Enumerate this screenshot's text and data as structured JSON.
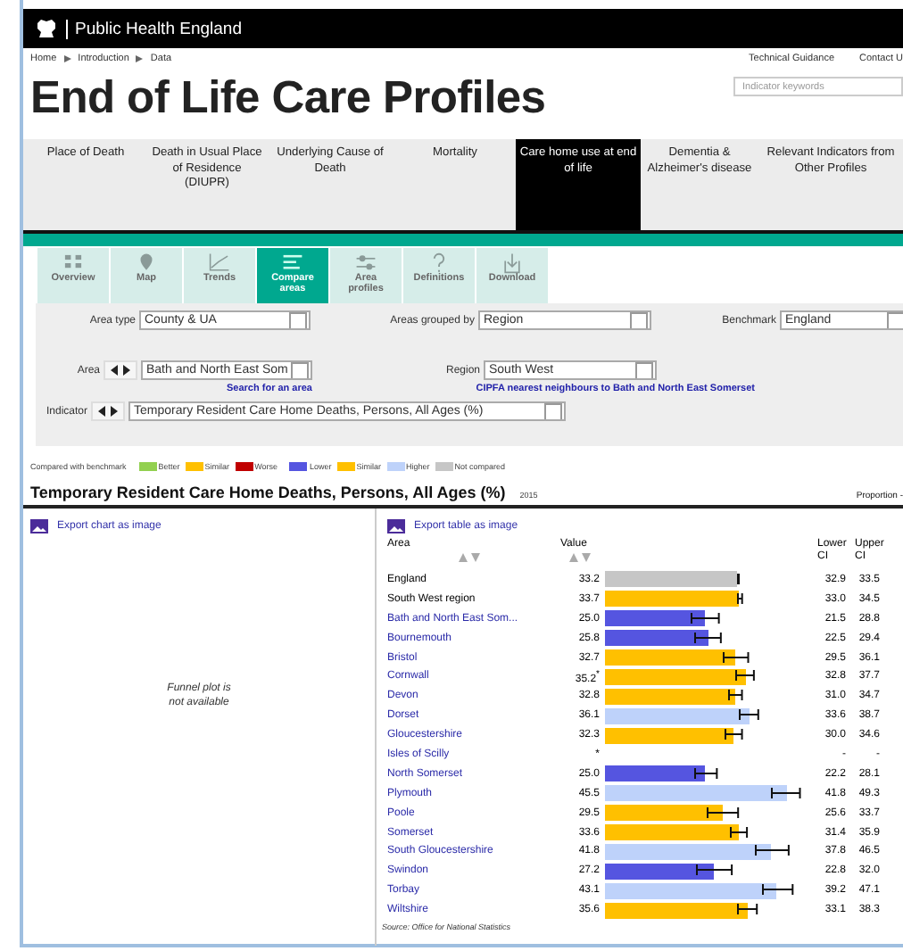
{
  "header": {
    "org": "Public Health England"
  },
  "breadcrumb": [
    "Home",
    "Introduction",
    "Data"
  ],
  "top_links": [
    "Technical Guidance",
    "Contact U"
  ],
  "title": "End of Life Care Profiles",
  "search": {
    "placeholder": "Indicator keywords"
  },
  "nav": [
    {
      "label": "Place of Death",
      "selected": false
    },
    {
      "label": "Death in Usual Place of Residence (DIUPR)",
      "selected": false
    },
    {
      "label": "Underlying Cause of Death",
      "selected": false
    },
    {
      "label": "Mortality",
      "selected": false
    },
    {
      "label": "Care home use at end of life",
      "selected": true
    },
    {
      "label": "Dementia & Alzheimer's disease",
      "selected": false
    },
    {
      "label": "Relevant Indicators from Other Profiles",
      "selected": false
    }
  ],
  "tools": [
    {
      "kind": "overview",
      "label": "Overview",
      "selected": false
    },
    {
      "kind": "map",
      "label": "Map",
      "selected": false
    },
    {
      "kind": "trends",
      "label": "Trends",
      "selected": false
    },
    {
      "kind": "compare",
      "label": "Compare areas",
      "selected": true
    },
    {
      "kind": "profiles",
      "label": "Area profiles",
      "selected": false
    },
    {
      "kind": "definitions",
      "label": "Definitions",
      "selected": false
    },
    {
      "kind": "download",
      "label": "Download",
      "selected": false
    }
  ],
  "filters": {
    "area_type": {
      "label": "Area type",
      "value": "County & UA"
    },
    "areas_grouped_by": {
      "label": "Areas grouped by",
      "value": "Region"
    },
    "benchmark": {
      "label": "Benchmark",
      "value": "England"
    },
    "area": {
      "label": "Area",
      "value": "Bath and North East Som",
      "link": "Search for an area"
    },
    "region": {
      "label": "Region",
      "value": "South West",
      "link": "CIPFA nearest neighbours to Bath and North East Somerset"
    },
    "indicator": {
      "label": "Indicator",
      "value": "Temporary Resident Care Home Deaths, Persons, All Ages (%)"
    }
  },
  "legend": {
    "label": "Compared with benchmark",
    "groups": [
      {
        "items": [
          {
            "label": "Better",
            "color": "#92d050"
          },
          {
            "label": "Similar",
            "color": "#ffc000"
          },
          {
            "label": "Worse",
            "color": "#c00000"
          }
        ]
      },
      {
        "items": [
          {
            "label": "Lower",
            "color": "#5555e0"
          },
          {
            "label": "Similar",
            "color": "#ffc000"
          },
          {
            "label": "Higher",
            "color": "#bed2fa"
          },
          {
            "label": "Not compared",
            "color": "#c6c6c6"
          }
        ]
      }
    ]
  },
  "indicator_title": "Temporary Resident Care Home Deaths, Persons, All Ages (%)",
  "period": "2015",
  "value_type": "Proportion -",
  "chart_panel": {
    "export_link": "Export chart as image",
    "message": "Funnel plot is not available"
  },
  "table": {
    "export_link": "Export table as image",
    "columns": [
      "Area",
      "Value",
      "Lower CI",
      "Upper CI"
    ],
    "rows": [
      {
        "kind": "benchmark",
        "area": "England",
        "value": "33.2",
        "level": 0.651,
        "color": "#c6c6c6",
        "lower": "32.9",
        "upper": "33.5"
      },
      {
        "kind": "benchmark",
        "area": "South West region",
        "value": "33.7",
        "level": 0.661,
        "color": "#ffc000",
        "lower": "33.0",
        "upper": "34.5"
      },
      {
        "kind": "area",
        "area": "Bath and North East Som...",
        "value": "25.0",
        "level": 0.49,
        "color": "#5555e0",
        "lower": "21.5",
        "upper": "28.8"
      },
      {
        "kind": "area",
        "area": "Bournemouth",
        "value": "25.8",
        "level": 0.506,
        "color": "#5555e0",
        "lower": "22.5",
        "upper": "29.4"
      },
      {
        "kind": "area",
        "area": "Bristol",
        "value": "32.7",
        "level": 0.641,
        "color": "#ffc000",
        "lower": "29.5",
        "upper": "36.1"
      },
      {
        "kind": "area",
        "area": "Cornwall",
        "value": "35.2$^{*}$",
        "level": 0.69,
        "color": "#ffc000",
        "lower": "32.8",
        "upper": "37.7"
      },
      {
        "kind": "area",
        "area": "Devon",
        "value": "32.8",
        "level": 0.643,
        "color": "#ffc000",
        "lower": "31.0",
        "upper": "34.7"
      },
      {
        "kind": "area",
        "area": "Dorset",
        "value": "36.1",
        "level": 0.708,
        "color": "#bed2fa",
        "lower": "33.6",
        "upper": "38.7"
      },
      {
        "kind": "area",
        "area": "Gloucestershire",
        "value": "32.3",
        "level": 0.633,
        "color": "#ffc000",
        "lower": "30.0",
        "upper": "34.6"
      },
      {
        "kind": "area",
        "area": "Isles of Scilly",
        "value": "*",
        "lower": "-",
        "upper": "-"
      },
      {
        "kind": "area",
        "area": "North Somerset",
        "value": "25.0",
        "level": 0.49,
        "color": "#5555e0",
        "lower": "22.2",
        "upper": "28.1"
      },
      {
        "kind": "area",
        "area": "Plymouth",
        "value": "45.5",
        "level": 0.892,
        "color": "#bed2fa",
        "lower": "41.8",
        "upper": "49.3"
      },
      {
        "kind": "area",
        "area": "Poole",
        "value": "29.5",
        "level": 0.578,
        "color": "#ffc000",
        "lower": "25.6",
        "upper": "33.7"
      },
      {
        "kind": "area",
        "area": "Somerset",
        "value": "33.6",
        "level": 0.659,
        "color": "#ffc000",
        "lower": "31.4",
        "upper": "35.9"
      },
      {
        "kind": "area",
        "area": "South Gloucestershire",
        "value": "41.8",
        "level": 0.82,
        "color": "#bed2fa",
        "lower": "37.8",
        "upper": "46.5"
      },
      {
        "kind": "area",
        "area": "Swindon",
        "value": "27.2",
        "level": 0.533,
        "color": "#5555e0",
        "lower": "22.8",
        "upper": "32.0"
      },
      {
        "kind": "area",
        "area": "Torbay",
        "value": "43.1",
        "level": 0.845,
        "color": "#bed2fa",
        "lower": "39.2",
        "upper": "47.1"
      },
      {
        "kind": "area",
        "area": "Wiltshire",
        "value": "35.6",
        "level": 0.698,
        "color": "#ffc000",
        "lower": "33.1",
        "upper": "38.3"
      }
    ],
    "source": "Source: Office for National Statistics"
  }
}
